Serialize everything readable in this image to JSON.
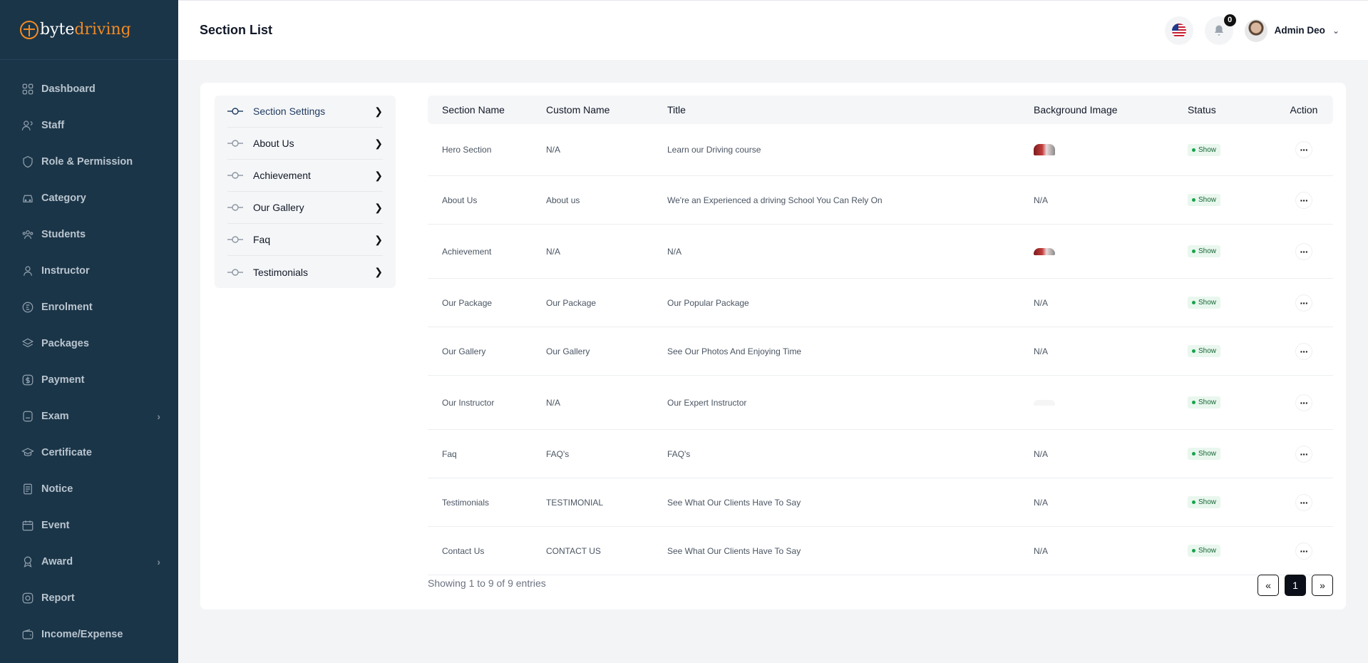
{
  "brand": {
    "part1": "byte",
    "part2": "driving"
  },
  "sidebar": {
    "items": [
      {
        "label": "Dashboard",
        "icon": "grid-icon"
      },
      {
        "label": "Staff",
        "icon": "users-icon"
      },
      {
        "label": "Role & Permission",
        "icon": "shield-icon"
      },
      {
        "label": "Category",
        "icon": "car-icon"
      },
      {
        "label": "Students",
        "icon": "group-icon"
      },
      {
        "label": "Instructor",
        "icon": "user-icon"
      },
      {
        "label": "Enrolment",
        "icon": "enrol-icon"
      },
      {
        "label": "Packages",
        "icon": "layers-icon"
      },
      {
        "label": "Payment",
        "icon": "dollar-icon"
      },
      {
        "label": "Exam",
        "icon": "exam-icon",
        "has_sub": true
      },
      {
        "label": "Certificate",
        "icon": "graduation-icon"
      },
      {
        "label": "Notice",
        "icon": "notice-icon"
      },
      {
        "label": "Event",
        "icon": "calendar-icon"
      },
      {
        "label": "Award",
        "icon": "award-icon",
        "has_sub": true
      },
      {
        "label": "Report",
        "icon": "report-icon"
      },
      {
        "label": "Income/Expense",
        "icon": "wallet-icon"
      }
    ]
  },
  "header": {
    "title": "Section List",
    "notifications": "0",
    "user_name": "Admin Deo"
  },
  "section_menu": [
    {
      "label": "Section Settings",
      "active": true
    },
    {
      "label": "About Us"
    },
    {
      "label": "Achievement"
    },
    {
      "label": "Our Gallery"
    },
    {
      "label": "Faq"
    },
    {
      "label": "Testimonials"
    }
  ],
  "table": {
    "columns": [
      "Section Name",
      "Custom Name",
      "Title",
      "Background Image",
      "Status",
      "Action"
    ],
    "rows": [
      {
        "section": "Hero Section",
        "custom": "N/A",
        "title": "Learn our Driving course",
        "image": "",
        "status": "Show"
      },
      {
        "section": "About Us",
        "custom": "About us",
        "title": "We're an Experienced a driving School You Can Rely On",
        "image": "N/A",
        "status": "Show"
      },
      {
        "section": "Achievement",
        "custom": "N/A",
        "title": "N/A",
        "image": "",
        "status": "Show"
      },
      {
        "section": "Our Package",
        "custom": "Our Package",
        "title": "Our Popular Package",
        "image": "N/A",
        "status": "Show"
      },
      {
        "section": "Our Gallery",
        "custom": "Our Gallery",
        "title": "See Our Photos And Enjoying Time",
        "image": "N/A",
        "status": "Show"
      },
      {
        "section": "Our Instructor",
        "custom": "N/A",
        "title": "Our Expert Instructor",
        "image": "",
        "status": "Show"
      },
      {
        "section": "Faq",
        "custom": "FAQ's",
        "title": "FAQ's",
        "image": "N/A",
        "status": "Show"
      },
      {
        "section": "Testimonials",
        "custom": "TESTIMONIAL",
        "title": "See What Our Clients Have To Say",
        "image": "N/A",
        "status": "Show"
      },
      {
        "section": "Contact Us",
        "custom": "CONTACT US",
        "title": "See What Our Clients Have To Say",
        "image": "N/A",
        "status": "Show"
      }
    ],
    "info": "Showing 1 to 9 of 9 entries"
  },
  "pagination": {
    "prev": "«",
    "current": "1",
    "next": "»"
  }
}
